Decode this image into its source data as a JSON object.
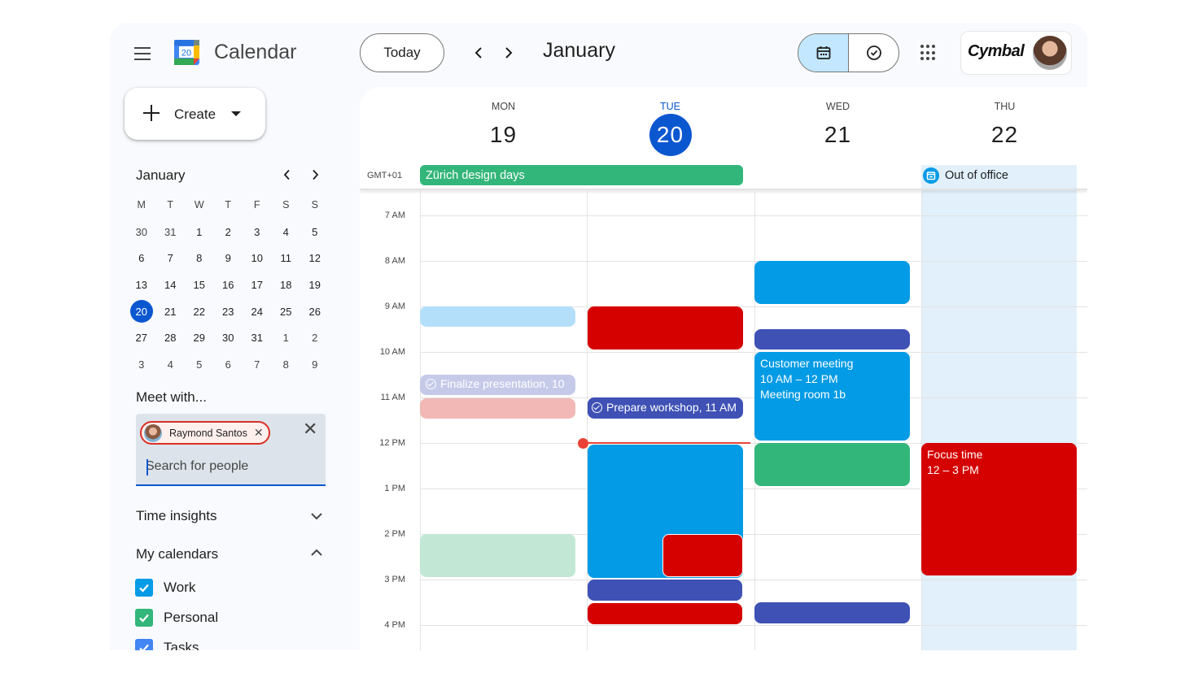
{
  "header": {
    "app_title": "Calendar",
    "logo_number": "20",
    "today_label": "Today",
    "month_title": "January",
    "brand": "Cymbal"
  },
  "create": {
    "label": "Create"
  },
  "mini_calendar": {
    "month": "January",
    "weekdays": [
      "M",
      "T",
      "W",
      "T",
      "F",
      "S",
      "S"
    ],
    "days": [
      [
        "30",
        "31",
        "1",
        "2",
        "3",
        "4",
        "5"
      ],
      [
        "6",
        "7",
        "8",
        "9",
        "10",
        "11",
        "12"
      ],
      [
        "13",
        "14",
        "15",
        "16",
        "17",
        "18",
        "19"
      ],
      [
        "20",
        "21",
        "22",
        "23",
        "24",
        "25",
        "26"
      ],
      [
        "27",
        "28",
        "29",
        "30",
        "31",
        "1",
        "2"
      ],
      [
        "3",
        "4",
        "5",
        "6",
        "7",
        "8",
        "9"
      ]
    ],
    "today": "20"
  },
  "meet_with": {
    "title": "Meet with...",
    "chip_name": "Raymond Santos",
    "placeholder": "Search for people"
  },
  "sidebar_sections": {
    "time_insights": "Time insights",
    "my_calendars": "My calendars"
  },
  "calendars": [
    {
      "label": "Work",
      "color": "#039be5",
      "checked": true
    },
    {
      "label": "Personal",
      "color": "#33b679",
      "checked": true
    },
    {
      "label": "Tasks",
      "color": "#4285f4",
      "checked": true
    }
  ],
  "week": {
    "timezone": "GMT+01",
    "days": [
      {
        "dow": "MON",
        "date": "19"
      },
      {
        "dow": "TUE",
        "date": "20"
      },
      {
        "dow": "WED",
        "date": "21"
      },
      {
        "dow": "THU",
        "date": "22"
      }
    ],
    "hours": [
      "7 AM",
      "8 AM",
      "9 AM",
      "10 AM",
      "11 AM",
      "12 PM",
      "1 PM",
      "2 PM",
      "3 PM",
      "4 PM"
    ]
  },
  "all_day_events": {
    "zurich": "Zürich design days",
    "out_of_office": "Out of office"
  },
  "events": {
    "finalize": "Finalize presentation, 10",
    "prepare": "Prepare workshop, 11 AM",
    "customer_title": "Customer meeting",
    "customer_time": "10 AM – 12 PM",
    "customer_room": "Meeting room 1b",
    "focus_title": "Focus time",
    "focus_time": "12 – 3 PM"
  },
  "colors": {
    "primary": "#0b57d0",
    "peacock": "#039be5",
    "tomato": "#d50000",
    "blueberry": "#3f51b5",
    "basil": "#33b679",
    "now_line": "#ea4335"
  }
}
